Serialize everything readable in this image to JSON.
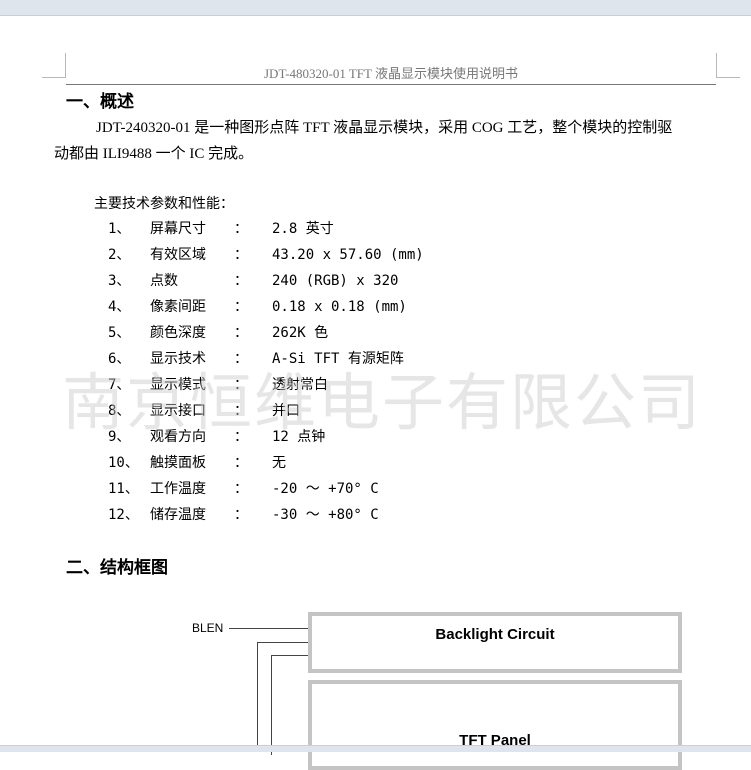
{
  "header": {
    "title": "JDT-480320-01   TFT 液晶显示模块使用说明书"
  },
  "section1": {
    "heading": "一、概述",
    "paragraph_line1": "JDT-240320-01 是一种图形点阵 TFT 液晶显示模块，采用 COG 工艺，整个模块的控制驱",
    "paragraph_line2": "动都由 ILI9488 一个 IC 完成。",
    "specs_title": "主要技术参数和性能：",
    "specs": [
      {
        "num": "1、",
        "label": "屏幕尺寸",
        "colon": "：",
        "value": "2.8 英寸"
      },
      {
        "num": "2、",
        "label": "有效区域",
        "colon": "：",
        "value": "43.20 x 57.60 (mm)"
      },
      {
        "num": "3、",
        "label": "点数",
        "colon": "：",
        "value": "240 (RGB)  x 320"
      },
      {
        "num": "4、",
        "label": "像素间距",
        "colon": "：",
        "value": "0.18 x 0.18 (mm)"
      },
      {
        "num": "5、",
        "label": "颜色深度",
        "colon": "：",
        "value": "262K 色"
      },
      {
        "num": "6、",
        "label": "显示技术",
        "colon": "：",
        "value": "A-Si TFT 有源矩阵"
      },
      {
        "num": "7、",
        "label": "显示模式",
        "colon": "：",
        "value": "透射常白"
      },
      {
        "num": "8、",
        "label": "显示接口",
        "colon": "：",
        "value": "并口"
      },
      {
        "num": "9、",
        "label": "观看方向",
        "colon": "：",
        "value": "12 点钟"
      },
      {
        "num": "10、",
        "label": "触摸面板",
        "colon": "：",
        "value": "无"
      },
      {
        "num": "11、",
        "label": "工作温度",
        "colon": "：",
        "value": "-20 ～ +70° C"
      },
      {
        "num": "12、",
        "label": "储存温度",
        "colon": "：",
        "value": "-30 ～ +80° C"
      }
    ]
  },
  "watermark": "南京恒维电子有限公司",
  "section2": {
    "heading": "二、结构框图",
    "diagram": {
      "signal_blen": "BLEN",
      "backlight_label": "Backlight Circuit",
      "panel_label": "TFT Panel"
    }
  }
}
